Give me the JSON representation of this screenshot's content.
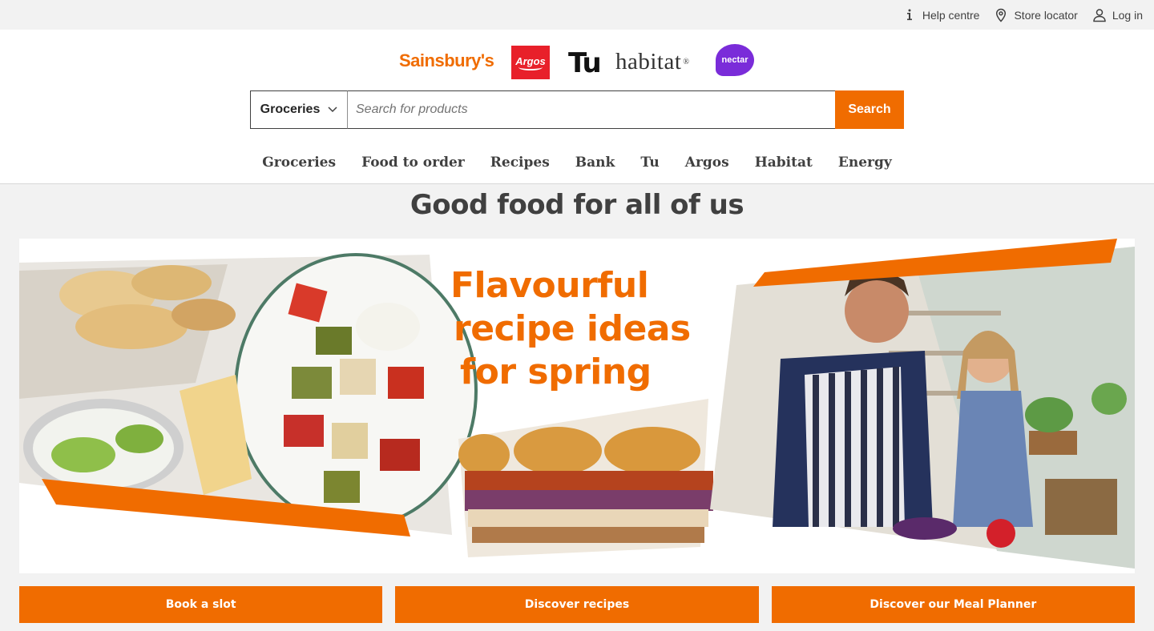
{
  "utility": {
    "help": "Help centre",
    "store": "Store locator",
    "login": "Log in"
  },
  "brands": {
    "sainsburys": "Sainsbury's",
    "argos": "Argos",
    "tu": "Tu",
    "habitat": "habitat",
    "nectar": "nectar"
  },
  "search": {
    "category": "Groceries",
    "placeholder": "Search for products",
    "button": "Search"
  },
  "nav": [
    "Groceries",
    "Food to order",
    "Recipes",
    "Bank",
    "Tu",
    "Argos",
    "Habitat",
    "Energy"
  ],
  "headline": "Good food for all of us",
  "hero": {
    "title_lines": [
      "Flavourful",
      "recipe ideas",
      "for spring"
    ]
  },
  "cta": [
    "Book a slot",
    "Discover recipes",
    "Discover our Meal Planner"
  ],
  "colors": {
    "brand_orange": "#f06c00",
    "text": "#404040",
    "argos_red": "#e8202a",
    "nectar_purple": "#7a2cd9"
  }
}
